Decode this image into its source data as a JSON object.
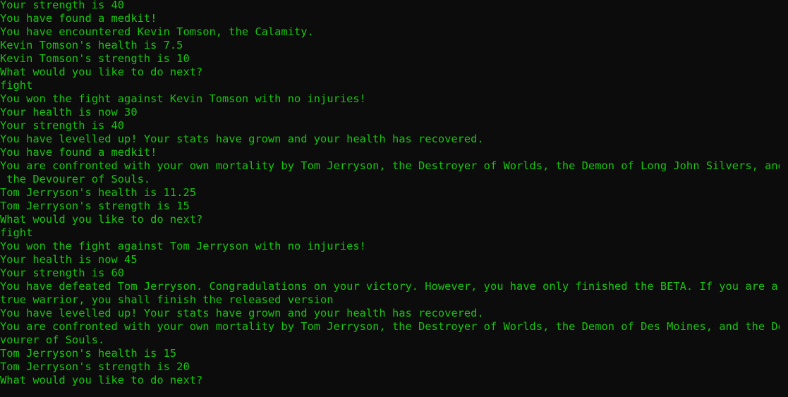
{
  "terminal": {
    "lines": [
      "Your strength is 40",
      "You have found a medkit!",
      "You have encountered Kevin Tomson, the Calamity.",
      "Kevin Tomson's health is 7.5",
      "Kevin Tomson's strength is 10",
      "What would you like to do next?",
      "fight",
      "You won the fight against Kevin Tomson with no injuries!",
      "Your health is now 30",
      "Your strength is 40",
      "You have levelled up! Your stats have grown and your health has recovered.",
      "You have found a medkit!",
      "You are confronted with your own mortality by Tom Jerryson, the Destroyer of Worlds, the Demon of Long John Silvers, and",
      " the Devourer of Souls.",
      "Tom Jerryson's health is 11.25",
      "Tom Jerryson's strength is 15",
      "What would you like to do next?",
      "fight",
      "You won the fight against Tom Jerryson with no injuries!",
      "Your health is now 45",
      "Your strength is 60",
      "You have defeated Tom Jerryson. Congradulations on your victory. However, you have only finished the BETA. If you are a",
      "true warrior, you shall finish the released version",
      "You have levelled up! Your stats have grown and your health has recovered.",
      "You are confronted with your own mortality by Tom Jerryson, the Destroyer of Worlds, the Demon of Des Moines, and the De",
      "vourer of Souls.",
      "Tom Jerryson's health is 15",
      "Tom Jerryson's strength is 20",
      "What would you like to do next?"
    ]
  },
  "colors": {
    "background": "#0c0c0c",
    "text": "#16c60c"
  }
}
